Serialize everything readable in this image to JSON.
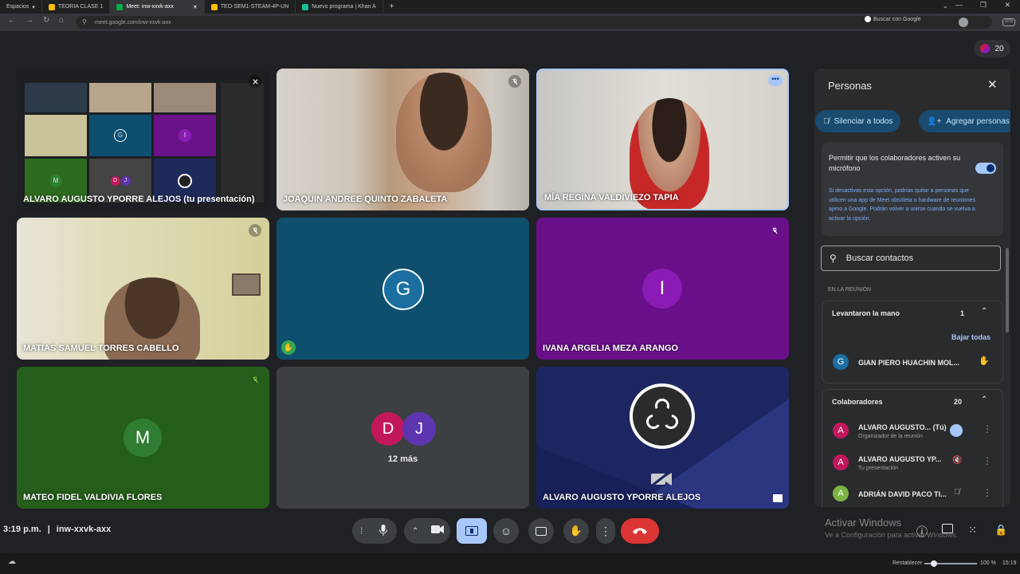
{
  "browser": {
    "workspaces_label": "Espacios",
    "tabs": [
      {
        "label": "TEORIA CLASE 1",
        "color": "#fbbc04"
      },
      {
        "label": "Meet: inw-xxvk-axx",
        "color": "#00ac47"
      },
      {
        "label": "TEO-SEM1-STEAM-4P-UN",
        "color": "#fbbc04"
      },
      {
        "label": "Nuevo programa | Khan A",
        "color": "#14bf96"
      }
    ],
    "url": "meet.google.com/inw-xxvk-axx",
    "search_label": "Buscar con Google"
  },
  "participants_count": "20",
  "tiles": [
    {
      "name": "ALVARO AUGUSTO YPORRE ALEJOS (tu presentación)"
    },
    {
      "name": "JOAQUIN ANDREE QUINTO ZABALETA"
    },
    {
      "name": "MÍA REGINA VALDIVIEZO TAPIA"
    },
    {
      "name": "MATIAS SAMUEL TORRES CABELLO"
    },
    {
      "name": "",
      "avatar_letter": "G",
      "avatar_color": "#1a6fa0"
    },
    {
      "name": "IVANA ARGELIA MEZA ARANGO",
      "avatar_letter": "I",
      "avatar_color": "#8a1cb5"
    },
    {
      "name": "MATEO FIDEL VALDIVIA FLORES",
      "avatar_letter": "M",
      "avatar_color": "#2e7d32"
    },
    {
      "name": "",
      "avatar_letters": [
        "D",
        "J"
      ],
      "more_label": "12 más"
    },
    {
      "name": "ALVARO AUGUSTO YPORRE ALEJOS"
    }
  ],
  "presentation_mini": {
    "letters": [
      "G",
      "I",
      "M",
      "D",
      "J"
    ]
  },
  "panel": {
    "title": "Personas",
    "mute_all_label": "Silenciar a todos",
    "add_people_label": "Agregar personas",
    "mic_toggle_title": "Permitir que los colaboradores activen su micrófono",
    "mic_toggle_desc": "Si desactivas esta opción, podrías quitar a personas que utilicen una app de Meet obsoleta o hardware de reuniones ajeno a Google. Podrán volver a unirse cuando se vuelva a activar la opción.",
    "search_placeholder": "Buscar contactos",
    "section_label": "EN LA REUNIÓN",
    "raised_hands": {
      "label": "Levantaron la mano",
      "count": "1",
      "lower_all": "Bajar todas",
      "person": {
        "letter": "G",
        "name": "GIAN PIERO HUACHIN MOL...",
        "color": "#1a6fa0"
      }
    },
    "collaborators": {
      "label": "Colaboradores",
      "count": "20",
      "people": [
        {
          "letter": "A",
          "name": "ALVARO AUGUSTO... (Tú)",
          "sub": "Organizador de la reunión",
          "color": "#c2185b"
        },
        {
          "letter": "A",
          "name": "ALVARO AUGUSTO YP...",
          "sub": "Tu presentación",
          "color": "#c2185b"
        },
        {
          "letter": "A",
          "name": "ADRIÁN DAVID PACO TI...",
          "sub": "",
          "color": "#7cb342"
        }
      ]
    }
  },
  "bottom": {
    "time": "3:19 p.m.",
    "separator": "|",
    "code": "inw-xxvk-axx"
  },
  "watermark": {
    "title": "Activar Windows",
    "sub": "Ve a Configuración para activar Windows."
  },
  "taskbar": {
    "zoom_reset": "Restablecer",
    "zoom": "100 %",
    "clock": "15:19"
  }
}
